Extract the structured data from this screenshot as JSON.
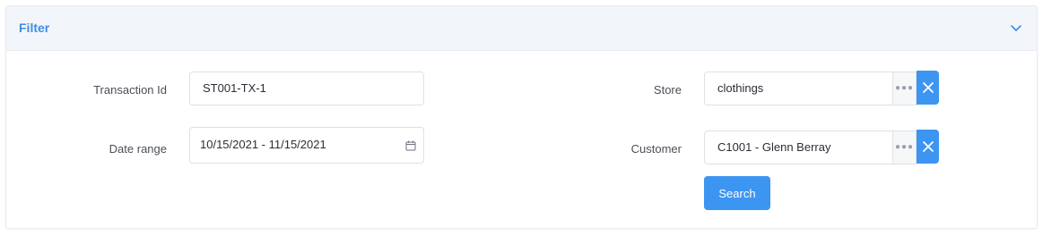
{
  "filter": {
    "title": "Filter",
    "fields": {
      "transaction_id": {
        "label": "Transaction Id",
        "value": "ST001-TX-1"
      },
      "date_range": {
        "label": "Date range",
        "value": "10/15/2021 - 11/15/2021"
      },
      "store": {
        "label": "Store",
        "value": "clothings"
      },
      "customer": {
        "label": "Customer",
        "value": "C1001 - Glenn Berray"
      }
    },
    "search_label": "Search"
  },
  "colors": {
    "accent": "#3d95f2",
    "header_bg": "#f2f5f9",
    "title": "#3d8ee8"
  },
  "icons": {
    "collapse": "chevron-down-icon",
    "calendar": "calendar-icon",
    "more": "ellipsis-icon",
    "clear": "close-icon"
  }
}
